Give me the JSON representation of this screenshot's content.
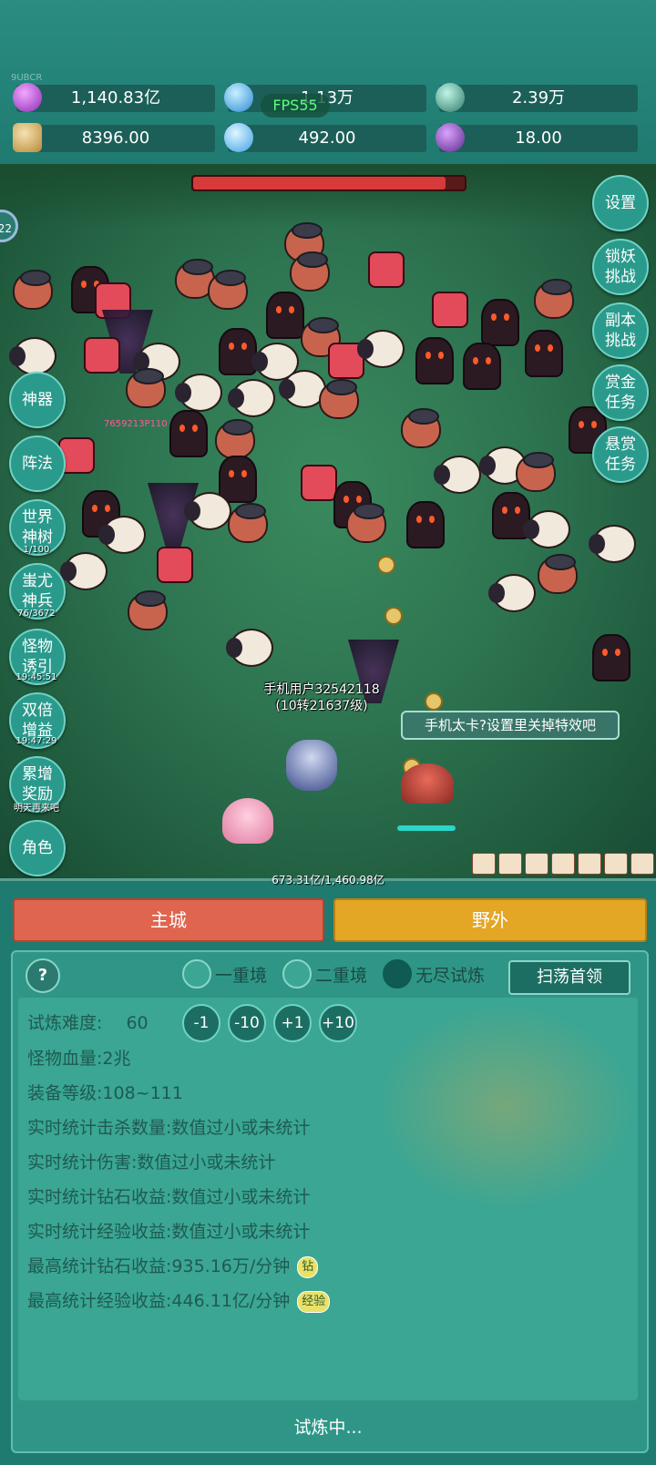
{
  "top_tiny_label": "9UBCR",
  "fps": "FPS55",
  "resources": [
    {
      "icon": "purple-gem-icon",
      "value": "1,140.83亿"
    },
    {
      "icon": "blue-crystal-icon",
      "value": "1.13万"
    },
    {
      "icon": "green-orb-icon",
      "value": "2.39万"
    },
    {
      "icon": "scroll-icon",
      "value": "8396.00"
    },
    {
      "icon": "ice-crystal-icon",
      "value": "492.00"
    },
    {
      "icon": "purple-pot-icon",
      "value": "18.00"
    }
  ],
  "side_level": "22",
  "right_buttons": [
    "设置",
    "锁妖\n挑战",
    "副本\n挑战",
    "赏金\n任务",
    "悬赏\n任务"
  ],
  "left_buttons": [
    {
      "label": "神器",
      "sub": ""
    },
    {
      "label": "阵法",
      "sub": ""
    },
    {
      "label": "世界\n神树",
      "sub": "1/100"
    },
    {
      "label": "蚩尤\n神兵",
      "sub": "76/3672"
    },
    {
      "label": "怪物\n诱引",
      "sub": "19:45:51"
    },
    {
      "label": "双倍\n增益",
      "sub": "19:47:29"
    },
    {
      "label": "累增\n奖励",
      "sub": "明天再来吧"
    },
    {
      "label": "角色",
      "sub": ""
    }
  ],
  "damage_number": "7659213P110",
  "player": {
    "name": "手机用户32542118",
    "level": "(10转21637级)"
  },
  "tip": "手机太卡?设置里关掉特效吧",
  "boss_hp": 0.93,
  "progress_text": "673.31亿/1,460.98亿",
  "tabs": {
    "main_city": "主城",
    "wild": "野外"
  },
  "help": "?",
  "modes": [
    {
      "label": "一重境",
      "selected": false
    },
    {
      "label": "二重境",
      "selected": false
    },
    {
      "label": "无尽试炼",
      "selected": true
    }
  ],
  "sweep_label": "扫荡首领",
  "difficulty_label": "试炼难度:",
  "difficulty_value": "60",
  "steppers": [
    "-1",
    "-10",
    "+1",
    "+10"
  ],
  "stats": [
    "怪物血量:2兆",
    "装备等级:108~111",
    "实时统计击杀数量:数值过小或未统计",
    "实时统计伤害:数值过小或未统计",
    "实时统计钻石收益:数值过小或未统计",
    "实时统计经验收益:数值过小或未统计",
    "最高统计钻石收益:935.16万/分钟",
    "最高统计经验收益:446.11亿/分钟"
  ],
  "badges": {
    "diamond": "钻",
    "exp": "经验"
  },
  "status": "试炼中...",
  "colors": {
    "main_city_tab": "#e0654f",
    "wild_tab": "#e3a625",
    "panel": "#2f9687"
  }
}
